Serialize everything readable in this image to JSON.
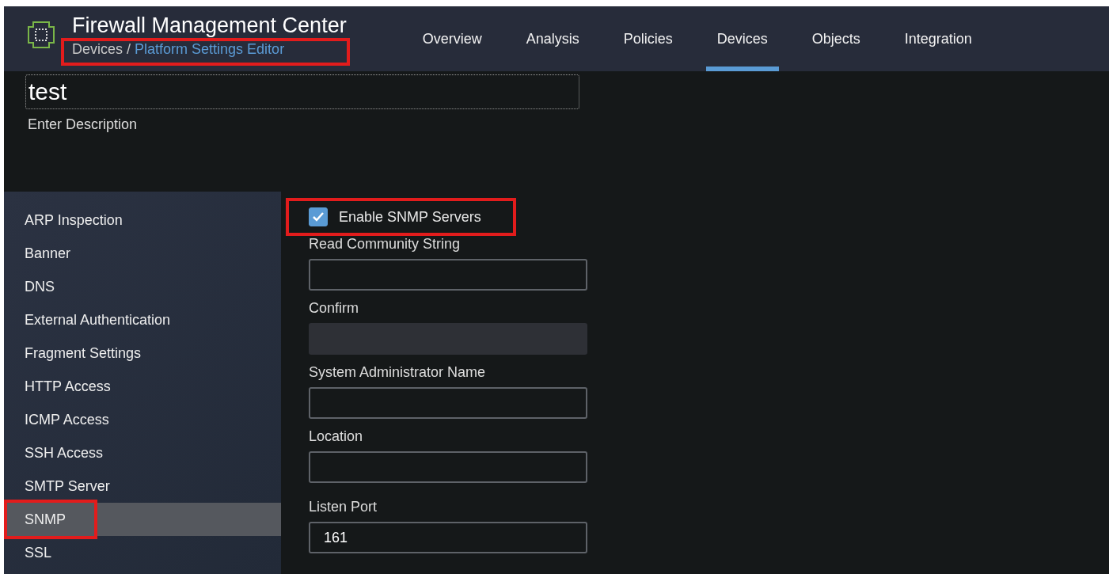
{
  "header": {
    "title": "Firewall Management Center",
    "breadcrumb": {
      "parent": "Devices",
      "separator": "/",
      "current": "Platform Settings Editor",
      "highlighted": true
    },
    "nav": [
      {
        "label": "Overview",
        "selected": false
      },
      {
        "label": "Analysis",
        "selected": false
      },
      {
        "label": "Policies",
        "selected": false
      },
      {
        "label": "Devices",
        "selected": true
      },
      {
        "label": "Objects",
        "selected": false
      },
      {
        "label": "Integration",
        "selected": false
      }
    ]
  },
  "policy": {
    "name": "test",
    "description_placeholder": "Enter Description"
  },
  "sidebar": {
    "items": [
      {
        "label": "ARP Inspection",
        "selected": false,
        "highlighted": false
      },
      {
        "label": "Banner",
        "selected": false,
        "highlighted": false
      },
      {
        "label": "DNS",
        "selected": false,
        "highlighted": false
      },
      {
        "label": "External Authentication",
        "selected": false,
        "highlighted": false
      },
      {
        "label": "Fragment Settings",
        "selected": false,
        "highlighted": false
      },
      {
        "label": "HTTP Access",
        "selected": false,
        "highlighted": false
      },
      {
        "label": "ICMP Access",
        "selected": false,
        "highlighted": false
      },
      {
        "label": "SSH Access",
        "selected": false,
        "highlighted": false
      },
      {
        "label": "SMTP Server",
        "selected": false,
        "highlighted": false
      },
      {
        "label": "SNMP",
        "selected": true,
        "highlighted": true
      },
      {
        "label": "SSL",
        "selected": false,
        "highlighted": false
      }
    ]
  },
  "snmp": {
    "enable": {
      "label": "Enable SNMP Servers",
      "checked": true,
      "highlighted": true
    },
    "fields": [
      {
        "label": "Read Community String",
        "disabled": false
      },
      {
        "label": "Confirm",
        "disabled": true
      },
      {
        "label": "System Administrator Name",
        "disabled": false
      },
      {
        "label": "Location",
        "disabled": false
      },
      {
        "label": "Listen Port",
        "value": "161",
        "disabled": false
      }
    ]
  }
}
